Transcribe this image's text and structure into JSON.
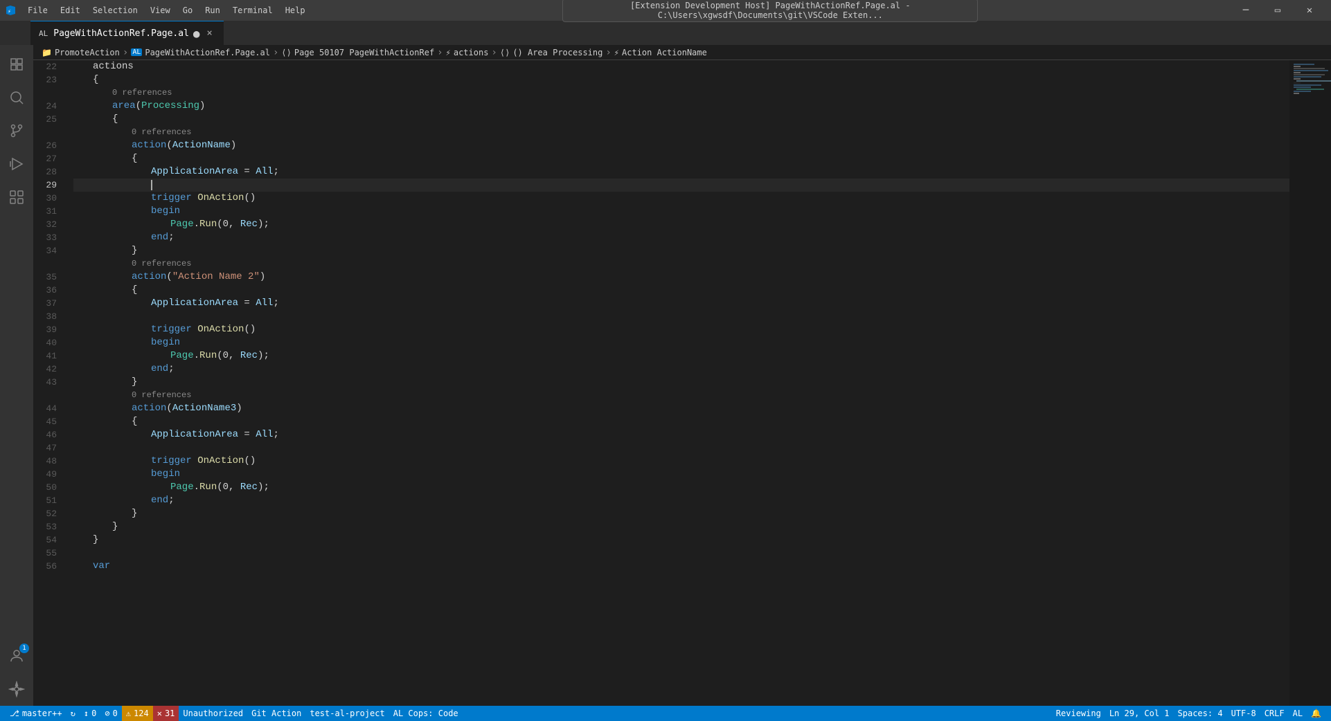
{
  "titlebar": {
    "icon": "⚡",
    "menu_items": [
      "File",
      "Edit",
      "Selection",
      "View",
      "Go",
      "Run",
      "Terminal",
      "Help"
    ],
    "path": "[Extension Development Host] PageWithActionRef.Page.al - C:\\Users\\xgwsdf\\Documents\\git\\VSCode Exten...",
    "controls": [
      "⬜",
      "❐",
      "✕"
    ]
  },
  "tab": {
    "al_badge": "AL",
    "label": "PageWithActionRef.Page.al",
    "modified": true,
    "close": "×"
  },
  "breadcrumb": {
    "items": [
      {
        "icon": "📁",
        "text": "PromoteAction"
      },
      {
        "sep": "›"
      },
      {
        "icon": "AL",
        "text": "PageWithActionRef.Page.al"
      },
      {
        "sep": "›"
      },
      {
        "icon": "⟨⟩",
        "text": "Page 50107 PageWithActionRef"
      },
      {
        "sep": "›"
      },
      {
        "icon": "⚡",
        "text": "actions"
      },
      {
        "sep": "›"
      },
      {
        "icon": "⟨⟩",
        "text": "() Area Processing"
      },
      {
        "sep": "›"
      },
      {
        "icon": "⚡",
        "text": "Action ActionName"
      }
    ]
  },
  "editor": {
    "lines": [
      {
        "num": 22,
        "tokens": [
          {
            "t": "indent",
            "w": 1
          },
          {
            "t": "kw-actions",
            "v": "actions"
          }
        ]
      },
      {
        "num": 23,
        "tokens": [
          {
            "t": "indent",
            "w": 1
          },
          {
            "t": "punct",
            "v": "{"
          }
        ]
      },
      {
        "num": null,
        "tokens": [
          {
            "t": "indent",
            "w": 2
          },
          {
            "t": "ref",
            "v": "0 references"
          }
        ]
      },
      {
        "num": 24,
        "tokens": [
          {
            "t": "indent",
            "w": 2
          },
          {
            "t": "keyword",
            "v": "area"
          },
          {
            "t": "punct",
            "v": "("
          },
          {
            "t": "type",
            "v": "Processing"
          },
          {
            "t": "punct",
            "v": ")"
          }
        ]
      },
      {
        "num": 25,
        "tokens": [
          {
            "t": "indent",
            "w": 2
          },
          {
            "t": "punct",
            "v": "{"
          }
        ]
      },
      {
        "num": null,
        "tokens": [
          {
            "t": "indent",
            "w": 3
          },
          {
            "t": "ref",
            "v": "0 references"
          }
        ]
      },
      {
        "num": 26,
        "tokens": [
          {
            "t": "indent",
            "w": 3
          },
          {
            "t": "keyword",
            "v": "action"
          },
          {
            "t": "punct",
            "v": "("
          },
          {
            "t": "var",
            "v": "ActionName"
          },
          {
            "t": "punct",
            "v": ")"
          }
        ]
      },
      {
        "num": 27,
        "tokens": [
          {
            "t": "indent",
            "w": 3
          },
          {
            "t": "punct",
            "v": "{"
          }
        ]
      },
      {
        "num": 28,
        "tokens": [
          {
            "t": "indent",
            "w": 4
          },
          {
            "t": "var",
            "v": "ApplicationArea"
          },
          {
            "t": "punct",
            "v": " = "
          },
          {
            "t": "var",
            "v": "All"
          },
          {
            "t": "punct",
            "v": ";"
          }
        ]
      },
      {
        "num": 29,
        "active": true,
        "tokens": []
      },
      {
        "num": 30,
        "tokens": [
          {
            "t": "indent",
            "w": 4
          },
          {
            "t": "keyword",
            "v": "trigger"
          },
          {
            "t": "punct",
            "v": " "
          },
          {
            "t": "func",
            "v": "OnAction"
          },
          {
            "t": "punct",
            "v": "()"
          }
        ]
      },
      {
        "num": 31,
        "tokens": [
          {
            "t": "indent",
            "w": 4
          },
          {
            "t": "keyword",
            "v": "begin"
          }
        ]
      },
      {
        "num": 32,
        "tokens": [
          {
            "t": "indent",
            "w": 5
          },
          {
            "t": "type",
            "v": "Page"
          },
          {
            "t": "punct",
            "v": "."
          },
          {
            "t": "func",
            "v": "Run"
          },
          {
            "t": "punct",
            "v": "(0, "
          },
          {
            "t": "var",
            "v": "Rec"
          },
          {
            "t": "punct",
            "v": ");"
          }
        ]
      },
      {
        "num": 33,
        "tokens": [
          {
            "t": "indent",
            "w": 4
          },
          {
            "t": "keyword",
            "v": "end"
          },
          {
            "t": "punct",
            "v": ";"
          }
        ]
      },
      {
        "num": 34,
        "tokens": [
          {
            "t": "indent",
            "w": 3
          },
          {
            "t": "punct",
            "v": "}"
          }
        ]
      },
      {
        "num": null,
        "tokens": [
          {
            "t": "indent",
            "w": 3
          },
          {
            "t": "ref",
            "v": "0 references"
          }
        ]
      },
      {
        "num": 35,
        "tokens": [
          {
            "t": "indent",
            "w": 3
          },
          {
            "t": "keyword",
            "v": "action"
          },
          {
            "t": "punct",
            "v": "("
          },
          {
            "t": "string",
            "v": "\"Action Name 2\""
          },
          {
            "t": "punct",
            "v": ")"
          }
        ]
      },
      {
        "num": 36,
        "tokens": [
          {
            "t": "indent",
            "w": 3
          },
          {
            "t": "punct",
            "v": "{"
          }
        ]
      },
      {
        "num": 37,
        "tokens": [
          {
            "t": "indent",
            "w": 4
          },
          {
            "t": "var",
            "v": "ApplicationArea"
          },
          {
            "t": "punct",
            "v": " = "
          },
          {
            "t": "var",
            "v": "All"
          },
          {
            "t": "punct",
            "v": ";"
          }
        ]
      },
      {
        "num": 38,
        "tokens": []
      },
      {
        "num": 39,
        "tokens": [
          {
            "t": "indent",
            "w": 4
          },
          {
            "t": "keyword",
            "v": "trigger"
          },
          {
            "t": "punct",
            "v": " "
          },
          {
            "t": "func",
            "v": "OnAction"
          },
          {
            "t": "punct",
            "v": "()"
          }
        ]
      },
      {
        "num": 40,
        "tokens": [
          {
            "t": "indent",
            "w": 4
          },
          {
            "t": "keyword",
            "v": "begin"
          }
        ]
      },
      {
        "num": 41,
        "tokens": [
          {
            "t": "indent",
            "w": 5
          },
          {
            "t": "type",
            "v": "Page"
          },
          {
            "t": "punct",
            "v": "."
          },
          {
            "t": "func",
            "v": "Run"
          },
          {
            "t": "punct",
            "v": "(0, "
          },
          {
            "t": "var",
            "v": "Rec"
          },
          {
            "t": "punct",
            "v": ");"
          }
        ]
      },
      {
        "num": 42,
        "tokens": [
          {
            "t": "indent",
            "w": 4
          },
          {
            "t": "keyword",
            "v": "end"
          },
          {
            "t": "punct",
            "v": ";"
          }
        ]
      },
      {
        "num": 43,
        "tokens": [
          {
            "t": "indent",
            "w": 3
          },
          {
            "t": "punct",
            "v": "}"
          }
        ]
      },
      {
        "num": null,
        "tokens": [
          {
            "t": "indent",
            "w": 3
          },
          {
            "t": "ref",
            "v": "0 references"
          }
        ]
      },
      {
        "num": 44,
        "tokens": [
          {
            "t": "indent",
            "w": 3
          },
          {
            "t": "keyword",
            "v": "action"
          },
          {
            "t": "punct",
            "v": "("
          },
          {
            "t": "var",
            "v": "ActionName3"
          },
          {
            "t": "punct",
            "v": ")"
          }
        ]
      },
      {
        "num": 45,
        "tokens": [
          {
            "t": "indent",
            "w": 3
          },
          {
            "t": "punct",
            "v": "{"
          }
        ]
      },
      {
        "num": 46,
        "tokens": [
          {
            "t": "indent",
            "w": 4
          },
          {
            "t": "var",
            "v": "ApplicationArea"
          },
          {
            "t": "punct",
            "v": " = "
          },
          {
            "t": "var",
            "v": "All"
          },
          {
            "t": "punct",
            "v": ";"
          }
        ]
      },
      {
        "num": 47,
        "tokens": []
      },
      {
        "num": 48,
        "tokens": [
          {
            "t": "indent",
            "w": 4
          },
          {
            "t": "keyword",
            "v": "trigger"
          },
          {
            "t": "punct",
            "v": " "
          },
          {
            "t": "func",
            "v": "OnAction"
          },
          {
            "t": "punct",
            "v": "()"
          }
        ]
      },
      {
        "num": 49,
        "tokens": [
          {
            "t": "indent",
            "w": 4
          },
          {
            "t": "keyword",
            "v": "begin"
          }
        ]
      },
      {
        "num": 50,
        "tokens": [
          {
            "t": "indent",
            "w": 5
          },
          {
            "t": "type",
            "v": "Page"
          },
          {
            "t": "punct",
            "v": "."
          },
          {
            "t": "func",
            "v": "Run"
          },
          {
            "t": "punct",
            "v": "(0, "
          },
          {
            "t": "var",
            "v": "Rec"
          },
          {
            "t": "punct",
            "v": ");"
          }
        ]
      },
      {
        "num": 51,
        "tokens": [
          {
            "t": "indent",
            "w": 4
          },
          {
            "t": "keyword",
            "v": "end"
          },
          {
            "t": "punct",
            "v": ";"
          }
        ]
      },
      {
        "num": 52,
        "tokens": [
          {
            "t": "indent",
            "w": 3
          },
          {
            "t": "punct",
            "v": "}"
          }
        ]
      },
      {
        "num": 53,
        "tokens": [
          {
            "t": "indent",
            "w": 2
          },
          {
            "t": "punct",
            "v": "}"
          }
        ]
      },
      {
        "num": 54,
        "tokens": [
          {
            "t": "indent",
            "w": 1
          },
          {
            "t": "punct",
            "v": "}"
          }
        ]
      },
      {
        "num": 55,
        "tokens": []
      },
      {
        "num": 56,
        "tokens": [
          {
            "t": "indent",
            "w": 1
          },
          {
            "t": "keyword",
            "v": "var"
          }
        ]
      }
    ],
    "cursor_line": 29,
    "cursor_col": 1
  },
  "status_bar": {
    "branch": "master++",
    "sync_icon": "↻",
    "remote_icon": "↕",
    "errors_icon": "⊘",
    "errors": "0",
    "warnings_icon": "⚠",
    "warnings": "124",
    "problems": "31",
    "unauthorized": "Unauthorized",
    "git_action": "Git Action",
    "project": "test-al-project",
    "cops": "AL Cops: Code",
    "reviewing": "Reviewing",
    "position": "Ln 29, Col 1",
    "spaces": "Spaces: 4",
    "encoding": "UTF-8",
    "line_ending": "CRLF",
    "language": "AL",
    "notification_count": "1"
  },
  "activity_bar": {
    "items": [
      {
        "icon": "files",
        "label": "Explorer",
        "active": false
      },
      {
        "icon": "search",
        "label": "Search",
        "active": false
      },
      {
        "icon": "source-control",
        "label": "Source Control",
        "active": false
      },
      {
        "icon": "run",
        "label": "Run and Debug",
        "active": false
      },
      {
        "icon": "extensions",
        "label": "Extensions",
        "active": false
      }
    ],
    "bottom_items": [
      {
        "icon": "accounts",
        "label": "Accounts",
        "badge": "1"
      },
      {
        "icon": "settings",
        "label": "Settings"
      }
    ]
  }
}
